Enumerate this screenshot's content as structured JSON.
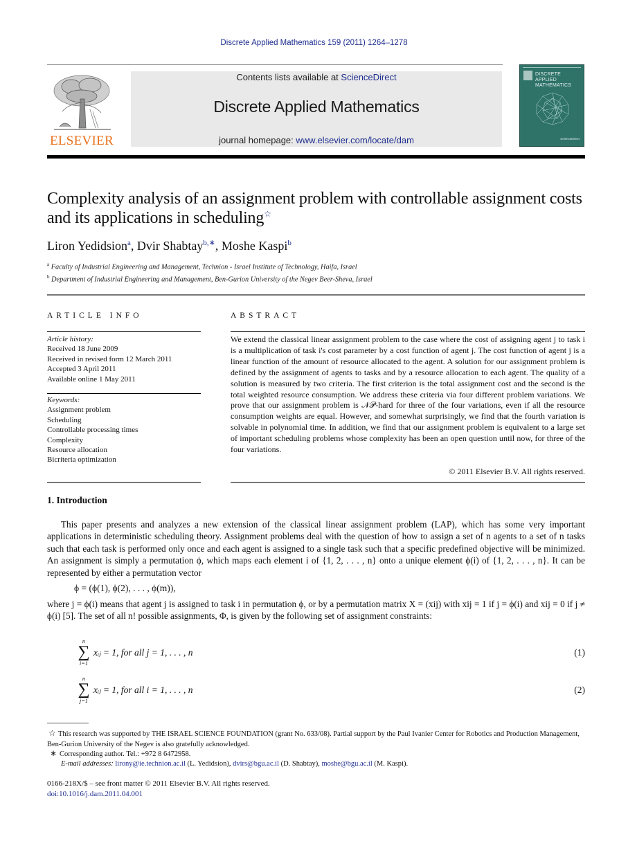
{
  "running_head": "Discrete Applied Mathematics 159 (2011) 1264–1278",
  "masthead": {
    "publisher_logo_text": "ELSEVIER",
    "contents_prefix": "Contents lists available at ",
    "contents_link": "ScienceDirect",
    "journal_title": "Discrete Applied Mathematics",
    "homepage_prefix": "journal homepage: ",
    "homepage_link": "www.elsevier.com/locate/dam",
    "cover_title_lines": [
      "DISCRETE",
      "APPLIED",
      "MATHEMATICS"
    ],
    "cover_color": "#2e7268",
    "logo_color": "#e9711c",
    "link_color": "#1f2e8f"
  },
  "article": {
    "title": "Complexity analysis of an assignment problem with controllable assignment costs and its applications in scheduling",
    "title_note_mark": "☆",
    "authors": [
      {
        "name": "Liron Yedidsion",
        "sup": "a"
      },
      {
        "name": "Dvir Shabtay",
        "sup": "b,∗"
      },
      {
        "name": "Moshe Kaspi",
        "sup": "b"
      }
    ],
    "affiliations": [
      {
        "mark": "a",
        "text": "Faculty of Industrial Engineering and Management, Technion - Israel Institute of Technology, Haifa, Israel"
      },
      {
        "mark": "b",
        "text": "Department of Industrial Engineering and Management, Ben-Gurion University of the Negev Beer-Sheva, Israel"
      }
    ]
  },
  "article_info": {
    "heading": "ARTICLE INFO",
    "history_label": "Article history:",
    "history": [
      "Received 18 June 2009",
      "Received in revised form 12 March 2011",
      "Accepted 3 April 2011",
      "Available online 1 May 2011"
    ],
    "keywords_label": "Keywords:",
    "keywords": [
      "Assignment problem",
      "Scheduling",
      "Controllable processing times",
      "Complexity",
      "Resource allocation",
      "Bicriteria optimization"
    ]
  },
  "abstract": {
    "heading": "ABSTRACT",
    "text": "We extend the classical linear assignment problem to the case where the cost of assigning agent j to task i is a multiplication of task i's cost parameter by a cost function of agent j. The cost function of agent j is a linear function of the amount of resource allocated to the agent. A solution for our assignment problem is defined by the assignment of agents to tasks and by a resource allocation to each agent. The quality of a solution is measured by two criteria. The first criterion is the total assignment cost and the second is the total weighted resource consumption. We address these criteria via four different problem variations. We prove that our assignment problem is 𝒩𝒫-hard for three of the four variations, even if all the resource consumption weights are equal. However, and somewhat surprisingly, we find that the fourth variation is solvable in polynomial time. In addition, we find that our assignment problem is equivalent to a large set of important scheduling problems whose complexity has been an open question until now, for three of the four variations.",
    "copyright": "© 2011 Elsevier B.V. All rights reserved."
  },
  "body": {
    "section_heading": "1.  Introduction",
    "paragraph_1": "This paper presents and analyzes a new extension of the classical linear assignment problem (LAP), which has some very important applications in deterministic scheduling theory. Assignment problems deal with the question of how to assign a set of n agents to a set of n tasks such that each task is performed only once and each agent is assigned to a single task such that a specific predefined objective will be minimized. An assignment is simply a permutation ϕ, which maps each element i of {1, 2, . . . , n} onto a unique element ϕ(i) of {1, 2, . . . , n}. It can be represented by either a permutation vector",
    "permutation_equation": "ϕ = (ϕ(1), ϕ(2), . . . , ϕ(m)),",
    "paragraph_2": "where j = ϕ(i) means that agent j is assigned to task i in permutation ϕ, or by a permutation matrix X = (xij) with xij = 1 if j = ϕ(i) and xij = 0 if j ≠ ϕ(i) [5]. The set of all n! possible assignments, Φ, is given by the following set of assignment constraints:",
    "equations": [
      {
        "upper": "n",
        "lower": "i=1",
        "expr": "xᵢⱼ = 1,    for all j = 1, . . . , n",
        "number": "(1)"
      },
      {
        "upper": "n",
        "lower": "j=1",
        "expr": "xᵢⱼ = 1,    for all i = 1, . . . , n",
        "number": "(2)"
      }
    ]
  },
  "footnotes": {
    "star_mark": "☆",
    "star_text": "This research was supported by THE ISRAEL SCIENCE FOUNDATION (grant No. 633/08). Partial support by the Paul Ivanier Center for Robotics and Production Management, Ben-Gurion University of the Negev is also gratefully acknowledged.",
    "corr_mark": "∗",
    "corr_text": "Corresponding author. Tel.: +972 8 6472958.",
    "email_label": "E-mail addresses:",
    "emails": [
      {
        "address": "lirony@ie.technion.ac.il",
        "who": " (L. Yedidsion), "
      },
      {
        "address": "dvirs@bgu.ac.il",
        "who": " (D. Shabtay), "
      },
      {
        "address": "moshe@bgu.ac.il",
        "who": " (M. Kaspi)."
      }
    ]
  },
  "front_matter": {
    "issn_line": "0166-218X/$ – see front matter © 2011 Elsevier B.V. All rights reserved.",
    "doi": "doi:10.1016/j.dam.2011.04.001"
  }
}
